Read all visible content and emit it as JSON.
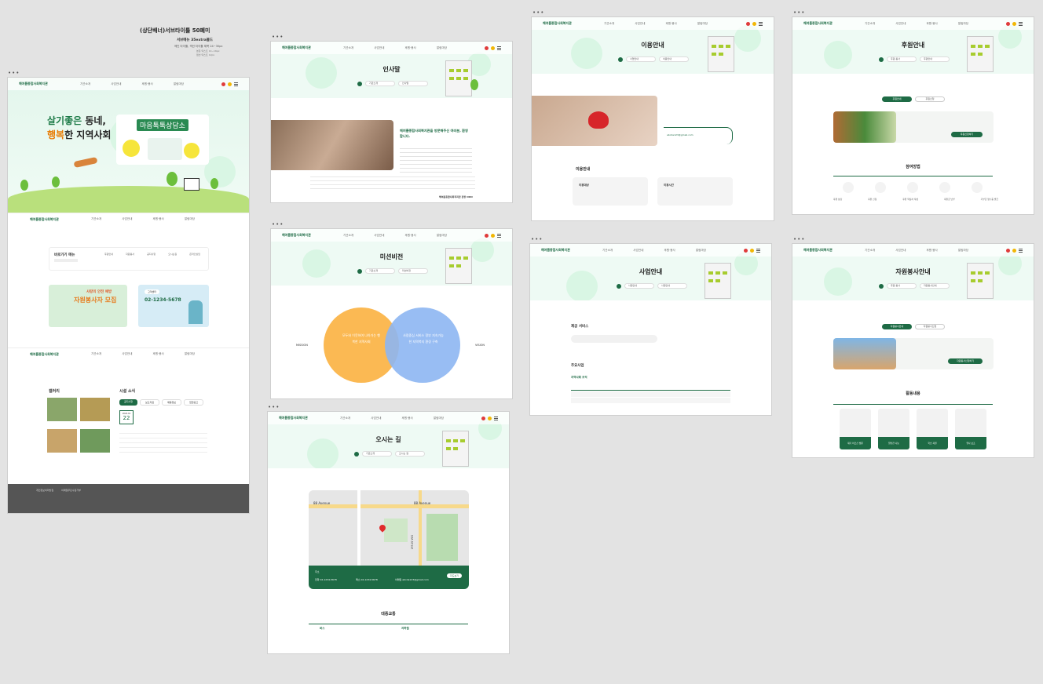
{
  "header": {
    "title": "(상단배너)서브타이틀 50폐미",
    "sub1": "서브메뉴 35extra볼드",
    "sub2": "메인 타이틀, 섹션 타이틀 제목 24~30px",
    "sub3": "본문 텍스트 14~16px",
    "sub4": "캡션 텍스트 12px"
  },
  "site": {
    "logo": "해여름종합사회복지관",
    "menu": [
      "기관소개",
      "사업안내",
      "후원·봉사",
      "알림마당",
      "참여마당"
    ]
  },
  "main": {
    "hero_line1a": "살기좋은",
    "hero_line1b": " 동네,",
    "hero_line2a": "행복",
    "hero_line2b": "한 지역사회",
    "hero_sign": "마음톡톡상담소",
    "quick_title": "바로가기 메뉴",
    "quick_items": [
      "후원안내",
      "자원봉사",
      "공지사항",
      "오시는길",
      "온라인상담"
    ],
    "volunteer_small": "사랑의 안전 예방",
    "volunteer_big": "자원봉사자 모집",
    "contact_label": "고객센터",
    "contact_phone": "02-1234-5678",
    "gallery_title": "갤러리",
    "news_title": "시설 소식",
    "news_tabs": [
      "공지사항",
      "보도자료",
      "채용정보",
      "입찰공고"
    ],
    "news_date_month": "2024.01",
    "news_date_day": "22",
    "footer_links": [
      "개인정보처리방침",
      "이메일무단수집거부"
    ]
  },
  "greeting": {
    "title": "인사말",
    "sel1": "기관소개",
    "sel2": "인사말",
    "headline": "해여름종합사회복지관을 방문해주신 여러분, 환영합니다.",
    "sign": "해여름종합사회복지관 관장 OOO"
  },
  "mission": {
    "title": "미션비전",
    "left_label": "MISSION",
    "right_label": "VISION",
    "left_text": "모두와 이웃하여 나아가는 행복한 지역사회",
    "right_text": "사람중심 서비스 정부 지속가능한 지역복지 환경 구축"
  },
  "location": {
    "title": "오시는 길",
    "street1": "88 Avenue",
    "street2": "88 Avenue",
    "street3": "10A Street",
    "addr_label": "주소",
    "phone_label": "전화",
    "fax_label": "팩스",
    "email_label": "이메일",
    "phone": "02-1234-5678",
    "fax": "02-1234-5678",
    "email": "abcde123@gmail.com",
    "map_button": "지도보기",
    "transit_title": "대중교통",
    "bus_label": "버스",
    "subway_label": "지하철"
  },
  "usage": {
    "title": "이용안내",
    "section": "이용안내",
    "card1": "이용대상",
    "card2": "이용시간",
    "email": "abcde123@gmail.com"
  },
  "business": {
    "title": "사업안내",
    "svc_title": "제공 서비스",
    "main_title": "주요사업",
    "sub_title": "지역사회 조직"
  },
  "sponsor": {
    "title": "후원안내",
    "tab1": "후원안내",
    "tab2": "후원신청",
    "method_title": "참여방법",
    "apply_btn": "후원신청하기",
    "steps": [
      "후원 상담",
      "후원 신청",
      "후원 약정서 작성",
      "후원금 납부",
      "기부금 영수증 발급"
    ]
  },
  "volunteer": {
    "title": "자원봉사안내",
    "tab1": "자원봉사안내",
    "tab2": "자원봉사신청",
    "apply_btn": "자원봉사신청하기",
    "section": "활동내용",
    "items": [
      "재가 어르신 방문",
      "밑반찬 나눔",
      "학습 지원",
      "행사 보조"
    ]
  }
}
